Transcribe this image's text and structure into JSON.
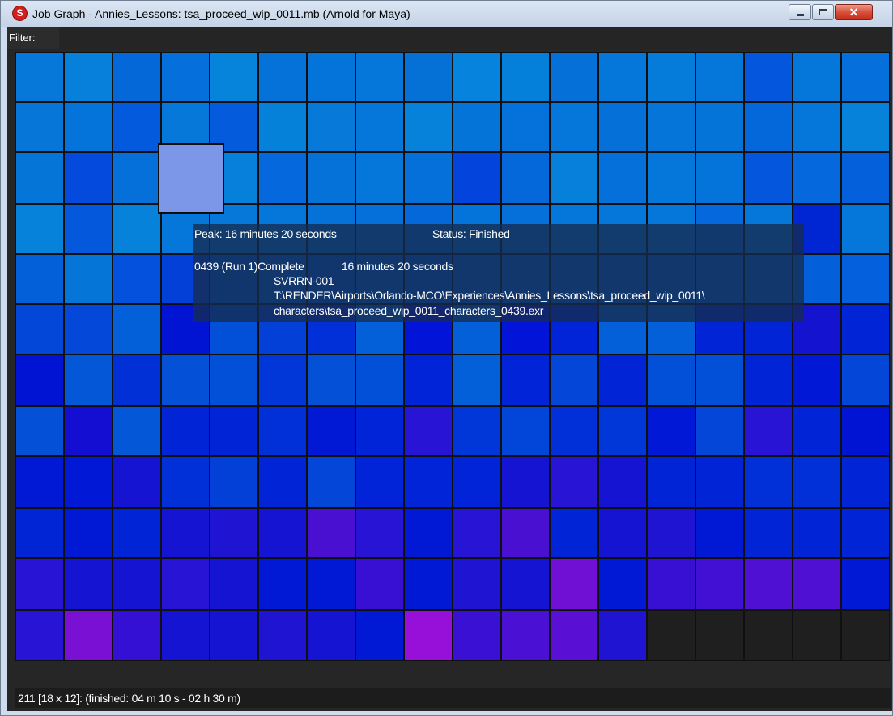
{
  "window": {
    "title": "Job Graph - Annies_Lessons: tsa_proceed_wip_0011.mb (Arnold for Maya)",
    "icon": "s-app-icon",
    "controls": {
      "minimize": "minimize-icon",
      "maximize": "maximize-icon",
      "close": "✕"
    }
  },
  "filter": {
    "label": "Filter:",
    "value": ""
  },
  "grid": {
    "columns": 18,
    "rows": 12,
    "task_count": 211,
    "selected_index": 39,
    "colors": [
      [
        "#0578da",
        "#0680da",
        "#0568d8",
        "#0570dc",
        "#0683da",
        "#0572da",
        "#0574da",
        "#0577da",
        "#0570d6",
        "#0683dc",
        "#0480da",
        "#0570d8",
        "#0576da",
        "#057cd9",
        "#0577da",
        "#0456dc",
        "#0576da",
        "#0570dc"
      ],
      [
        "#0677d8",
        "#0574da",
        "#045adc",
        "#0578da",
        "#045cdc",
        "#0681da",
        "#0679d9",
        "#0576da",
        "#0682da",
        "#0574d8",
        "#0571da",
        "#0577da",
        "#0570d8",
        "#0575da",
        "#0574d8",
        "#0568da",
        "#0576da",
        "#0682da"
      ],
      [
        "#0576d8",
        "#044adc",
        "#0570da",
        "#7c97e8",
        "#0680da",
        "#0568dc",
        "#0572da",
        "#0576da",
        "#0570da",
        "#0345dc",
        "#0568da",
        "#0680da",
        "#0570da",
        "#0576da",
        "#0574da",
        "#0456dc",
        "#0568dc",
        "#0560dc"
      ],
      [
        "#0682da",
        "#0458dc",
        "#0682da",
        "#0576da",
        "#0578da",
        "#0576da",
        "#0572da",
        "#0570da",
        "#0568da",
        "#0574da",
        "#0570da",
        "#0576da",
        "#0576da",
        "#0576da",
        "#0568dc",
        "#0576da",
        "#0025d2",
        "#0576da"
      ],
      [
        "#0460d8",
        "#0675d8",
        "#0351dc",
        "#0240d8",
        "#0458dc",
        "#0460da",
        "#0458da",
        "#0460da",
        "#0458da",
        "#0460da",
        "#0460da",
        "#0460da",
        "#0460da",
        "#0460da",
        "#0460da",
        "#0460da",
        "#0460da",
        "#0460dc"
      ],
      [
        "#0347d8",
        "#0348d8",
        "#0460d8",
        "#0114d4",
        "#0350d8",
        "#0240d8",
        "#0130d8",
        "#0460d8",
        "#0114d8",
        "#0460d8",
        "#0114d8",
        "#0124d8",
        "#0460d8",
        "#0460d8",
        "#0124d6",
        "#0124d6",
        "#1414d0",
        "#0124d6"
      ],
      [
        "#0114d4",
        "#0458d8",
        "#0130d6",
        "#0451d8",
        "#0350d8",
        "#0136d8",
        "#0451d8",
        "#0350d8",
        "#0124d8",
        "#0460d8",
        "#0124d8",
        "#0346d8",
        "#0124d6",
        "#0350d8",
        "#0350d8",
        "#0124d6",
        "#0118d6",
        "#0346d8"
      ],
      [
        "#0451d8",
        "#140ed2",
        "#0458d8",
        "#0124d6",
        "#0124d6",
        "#0130d8",
        "#0118d4",
        "#0124d8",
        "#2814d4",
        "#0136d8",
        "#0146d8",
        "#0130d8",
        "#0136d8",
        "#0118d6",
        "#0346d8",
        "#2814d4",
        "#0124d6",
        "#0114d4"
      ],
      [
        "#0118d4",
        "#0118d6",
        "#1414d2",
        "#0130d8",
        "#0240d8",
        "#0124d6",
        "#0346d8",
        "#0124d8",
        "#0124d8",
        "#0124d8",
        "#1414d2",
        "#2814d4",
        "#1414d2",
        "#0124d6",
        "#0124d6",
        "#0130d8",
        "#0130d8",
        "#0124d6"
      ],
      [
        "#0124d4",
        "#0118d4",
        "#0124d6",
        "#1414d2",
        "#1e14d2",
        "#1414d2",
        "#4a10d2",
        "#2814d4",
        "#0118d4",
        "#2814d4",
        "#4a10d2",
        "#0124d6",
        "#1414d2",
        "#1e14d2",
        "#0118d4",
        "#0124d6",
        "#0124d6",
        "#0124d6"
      ],
      [
        "#2814d4",
        "#1414d2",
        "#1414d2",
        "#2814d4",
        "#1414d2",
        "#0118d4",
        "#0118d4",
        "#3810d4",
        "#0118d4",
        "#1e14d2",
        "#1414d2",
        "#7010d4",
        "#0118d4",
        "#3810d4",
        "#4210d4",
        "#5010d4",
        "#5010d4",
        "#0118d4"
      ],
      [
        "#2814d4",
        "#7a10d4",
        "#3410d4",
        "#1414d2",
        "#1414d2",
        "#1e14d2",
        "#1414d2",
        "#0118d4",
        "#9610da",
        "#3a10d4",
        "#4a10d4",
        "#5a10d4",
        "#1e14d2"
      ]
    ]
  },
  "tooltip": {
    "peak": "Peak: 16 minutes 20 seconds",
    "status": "Status: Finished",
    "task": "0439 (Run 1)Complete",
    "duration": "16 minutes 20 seconds",
    "host": "SVRRN-001",
    "path_line1": "T:\\RENDER\\Airports\\Orlando-MCO\\Experiences\\Annies_Lessons\\tsa_proceed_wip_0011\\",
    "path_line2": "characters\\tsa_proceed_wip_0011_characters_0439.exr"
  },
  "status_bar": {
    "text": "211 [18 x 12]: (finished: 04 m 10 s - 02 h 30 m)"
  }
}
